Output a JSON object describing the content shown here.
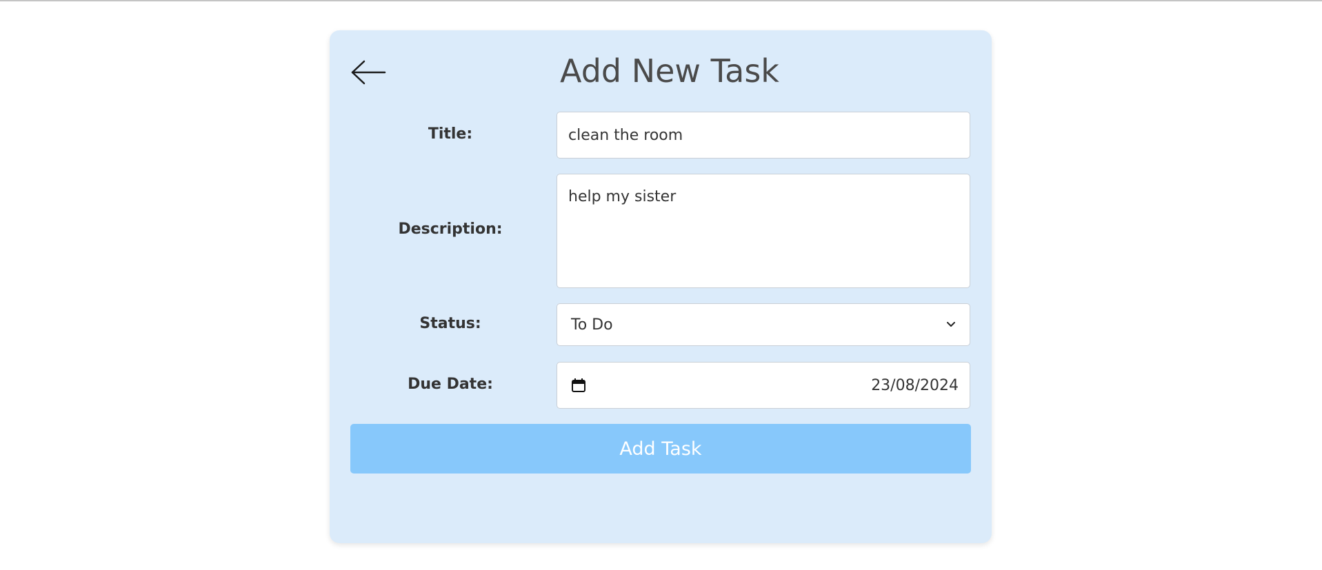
{
  "header": {
    "back_icon": "arrow-left-icon",
    "title": "Add New Task"
  },
  "form": {
    "title_label": "Title:",
    "title_value": "clean the room",
    "description_label": "Description:",
    "description_value": "help my sister",
    "status_label": "Status:",
    "status_value": "To Do",
    "due_date_label": "Due Date:",
    "due_date_value": "23/08/2024",
    "calendar_icon": "calendar-icon",
    "chevron_icon": "chevron-down-icon"
  },
  "actions": {
    "submit_label": "Add Task"
  },
  "colors": {
    "card_background": "#dbebfa",
    "button_background": "#87c8fb",
    "title_text": "#4a4a4a"
  }
}
